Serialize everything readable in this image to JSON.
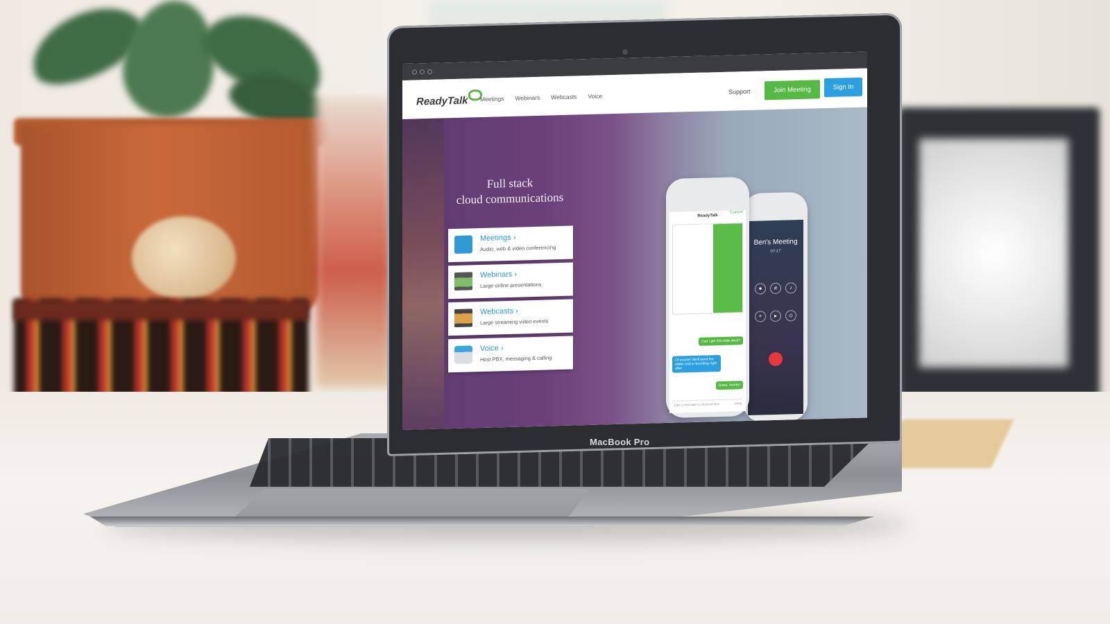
{
  "device": {
    "brand_label": "MacBook Pro"
  },
  "site": {
    "logo": "ReadyTalk",
    "nav": [
      "Meetings",
      "Webinars",
      "Webcasts",
      "Voice"
    ],
    "support_label": "Support",
    "join_button": "Join Meeting",
    "signin_button": "Sign In",
    "accent_green": "#56b845",
    "accent_blue": "#2b9fe0"
  },
  "hero": {
    "title_line1": "Full stack",
    "title_line2": "cloud communications"
  },
  "products": [
    {
      "title": "Meetings",
      "description": "Audio, web & video conferencing",
      "icon": "chat-bubbles-icon"
    },
    {
      "title": "Webinars",
      "description": "Large online presentations",
      "icon": "presentation-screen-icon"
    },
    {
      "title": "Webcasts",
      "description": "Large streaming video events",
      "icon": "video-screen-icon"
    },
    {
      "title": "Voice",
      "description": "Host PBX, messaging & calling",
      "icon": "phone-server-icon"
    }
  ],
  "phone_chat": {
    "title": "ReadyTalk",
    "cancel": "Cancel",
    "messages": [
      {
        "text": "Can I get this slide deck?",
        "side": "right"
      },
      {
        "text": "Of course! We'll send the slides and a recording right after.",
        "side": "left"
      },
      {
        "text": "Great, thanks!",
        "side": "right"
      }
    ],
    "input_placeholder": "Type a message to all presenters",
    "send_label": "Send"
  },
  "phone_call": {
    "title": "Ben's Meeting",
    "time": "07:17"
  }
}
